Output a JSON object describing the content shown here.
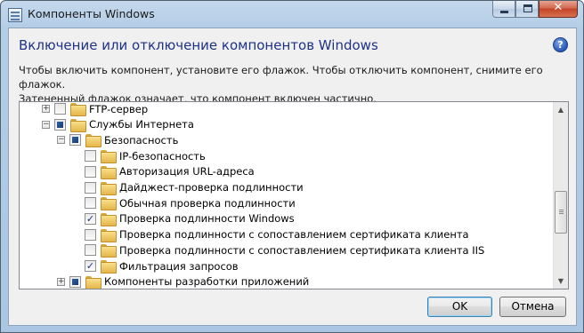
{
  "window": {
    "title": "Компоненты Windows",
    "title_icon": "window-features-icon",
    "caption": {
      "minimize_icon": "minimize-icon",
      "maximize_icon": "maximize-icon",
      "close_icon": "close-icon",
      "close_glyph": "✕"
    }
  },
  "dialog": {
    "heading": "Включение или отключение компонентов Windows",
    "help_glyph": "?",
    "description_line1": "Чтобы включить компонент, установите его флажок. Чтобы отключить компонент, снимите его флажок.",
    "description_line2": "Затененный флажок означает, что компонент включен частично."
  },
  "tree": {
    "items": [
      {
        "label": "FTP-сервер",
        "expander": "+",
        "check": "unchecked",
        "level": 0
      },
      {
        "label": "Службы Интернета",
        "expander": "−",
        "check": "partial",
        "level": 0
      },
      {
        "label": "Безопасность",
        "expander": "−",
        "check": "partial",
        "level": 1
      },
      {
        "label": "IP-безопасность",
        "expander": "",
        "check": "unchecked",
        "level": 2
      },
      {
        "label": "Авторизация URL-адреса",
        "expander": "",
        "check": "unchecked",
        "level": 2
      },
      {
        "label": "Дайджест-проверка подлинности",
        "expander": "",
        "check": "unchecked",
        "level": 2
      },
      {
        "label": "Обычная проверка подлинности",
        "expander": "",
        "check": "unchecked",
        "level": 2
      },
      {
        "label": "Проверка подлинности Windows",
        "expander": "",
        "check": "checked",
        "level": 2
      },
      {
        "label": "Проверка подлинности с сопоставлением сертификата клиента",
        "expander": "",
        "check": "unchecked",
        "level": 2
      },
      {
        "label": "Проверка подлинности с сопоставлением сертификата клиента IIS",
        "expander": "",
        "check": "unchecked",
        "level": 2
      },
      {
        "label": "Фильтрация запросов",
        "expander": "",
        "check": "checked",
        "level": 2
      },
      {
        "label": "Компоненты разработки приложений",
        "expander": "+",
        "check": "partial",
        "level": 1
      }
    ],
    "checkmark_glyph": "✓",
    "scrollbar": {
      "up_glyph": "▲",
      "down_glyph": "▼"
    }
  },
  "buttons": {
    "ok_label": "OK",
    "cancel_label": "Отмена"
  },
  "colors": {
    "heading": "#1e3287",
    "titlebar": "#b4cde6",
    "close_button": "#c4432a"
  }
}
